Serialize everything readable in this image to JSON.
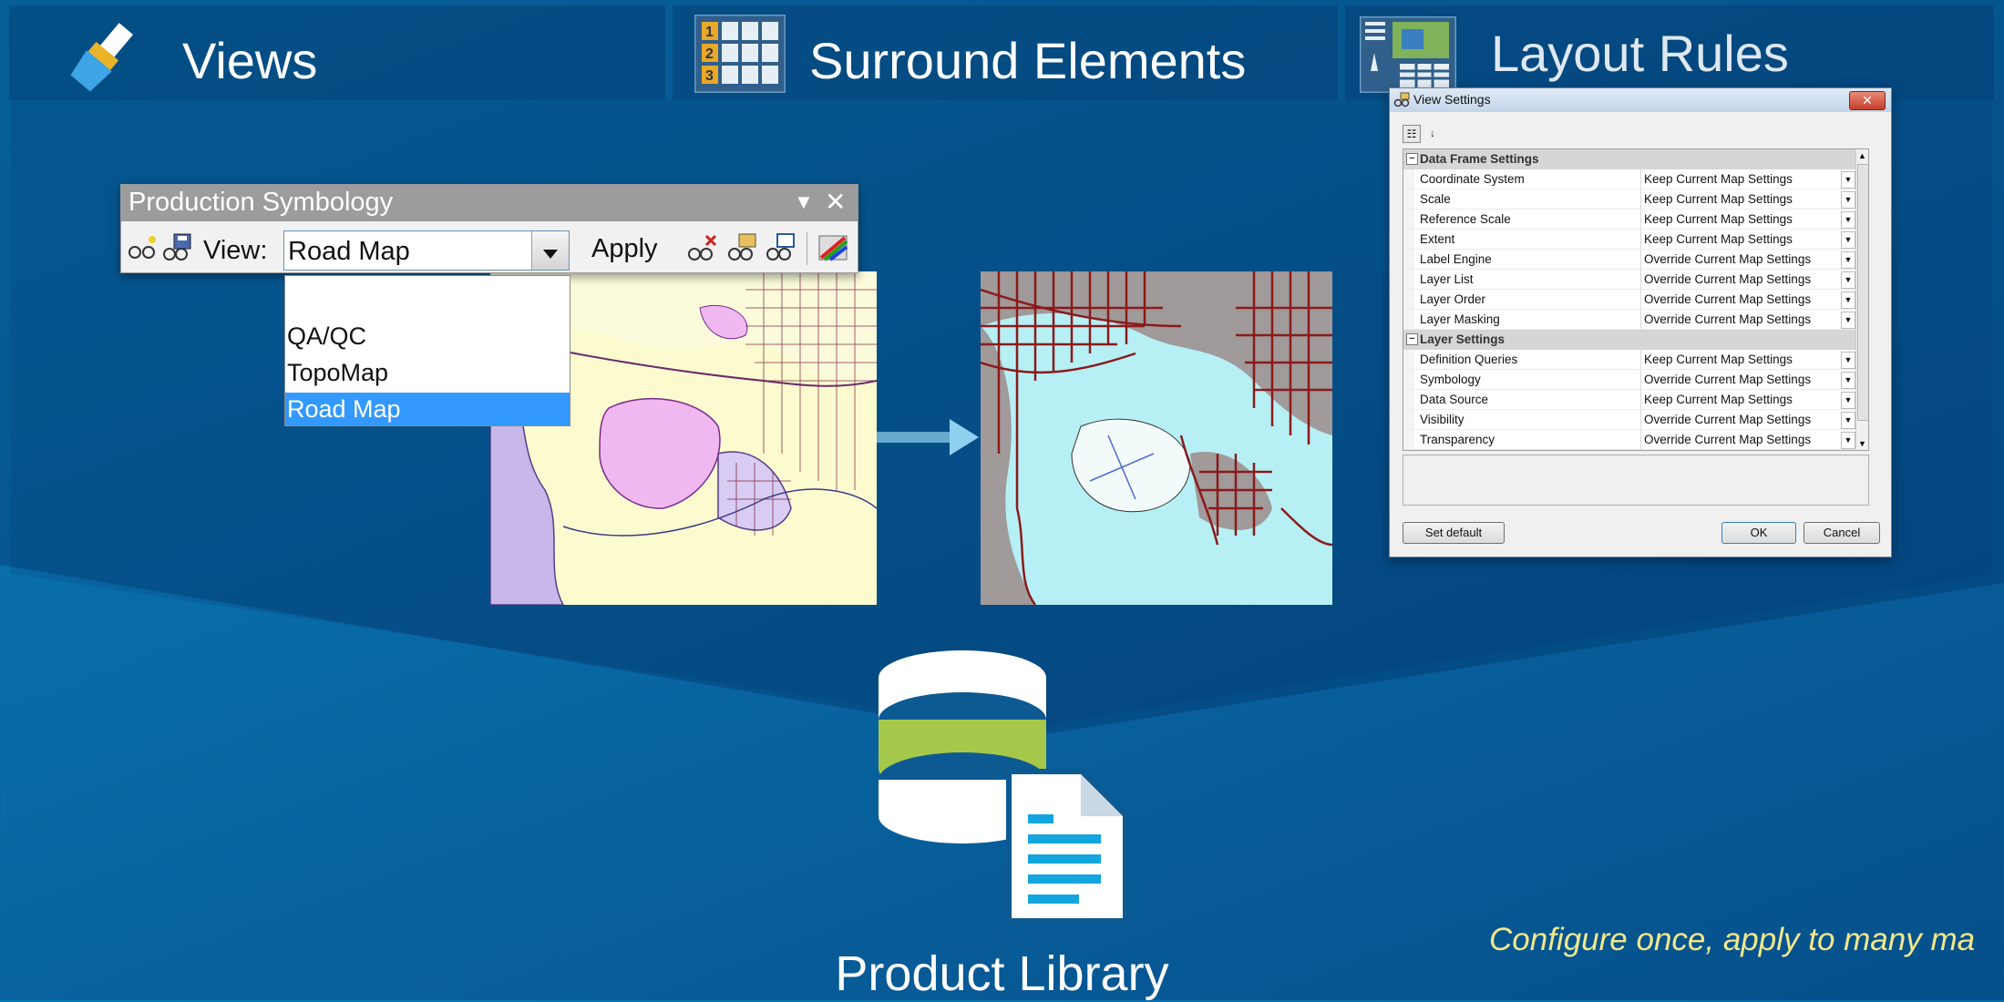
{
  "header": {
    "tabs": [
      {
        "label": "Views",
        "icon": "paintbrush-icon"
      },
      {
        "label": "Surround Elements",
        "icon": "grid-numbered-icon"
      },
      {
        "label": "Layout Rules",
        "icon": "layout-page-icon"
      }
    ]
  },
  "production_symbology": {
    "title": "Production Symbology",
    "view_label": "View:",
    "selected_view": "Road Map",
    "apply_label": "Apply",
    "dropdown_options": [
      "",
      "QA/QC",
      "TopoMap",
      "Road Map"
    ],
    "dropdown_selected": "Road Map"
  },
  "view_settings": {
    "title": "View Settings",
    "categories": [
      {
        "name": "Data Frame Settings",
        "rows": [
          {
            "name": "Coordinate System",
            "value": "Keep Current Map Settings"
          },
          {
            "name": "Scale",
            "value": "Keep Current Map Settings"
          },
          {
            "name": "Reference Scale",
            "value": "Keep Current Map Settings"
          },
          {
            "name": "Extent",
            "value": "Keep Current Map Settings"
          },
          {
            "name": "Label Engine",
            "value": "Override Current Map Settings"
          },
          {
            "name": "Layer List",
            "value": "Override Current Map Settings"
          },
          {
            "name": "Layer Order",
            "value": "Override Current Map Settings"
          },
          {
            "name": "Layer Masking",
            "value": "Override Current Map Settings"
          }
        ]
      },
      {
        "name": "Layer Settings",
        "rows": [
          {
            "name": "Definition Queries",
            "value": "Keep Current Map Settings"
          },
          {
            "name": "Symbology",
            "value": "Override Current Map Settings"
          },
          {
            "name": "Data Source",
            "value": "Keep Current Map Settings"
          },
          {
            "name": "Visibility",
            "value": "Override Current Map Settings"
          },
          {
            "name": "Transparency",
            "value": "Override Current Map Settings"
          }
        ]
      }
    ],
    "set_default_label": "Set default",
    "ok_label": "OK",
    "cancel_label": "Cancel"
  },
  "product_library": {
    "label": "Product Library",
    "icon": "database-document-icon"
  },
  "tagline": "Configure once, apply to many ma",
  "colors": {
    "accent_green": "#a6c84a",
    "db_dark": "#0d5a93",
    "doc_blue": "#12a5e0",
    "tagline": "#f2e88a",
    "road_red": "#8b1a1a",
    "water": "#b6f0f5"
  }
}
